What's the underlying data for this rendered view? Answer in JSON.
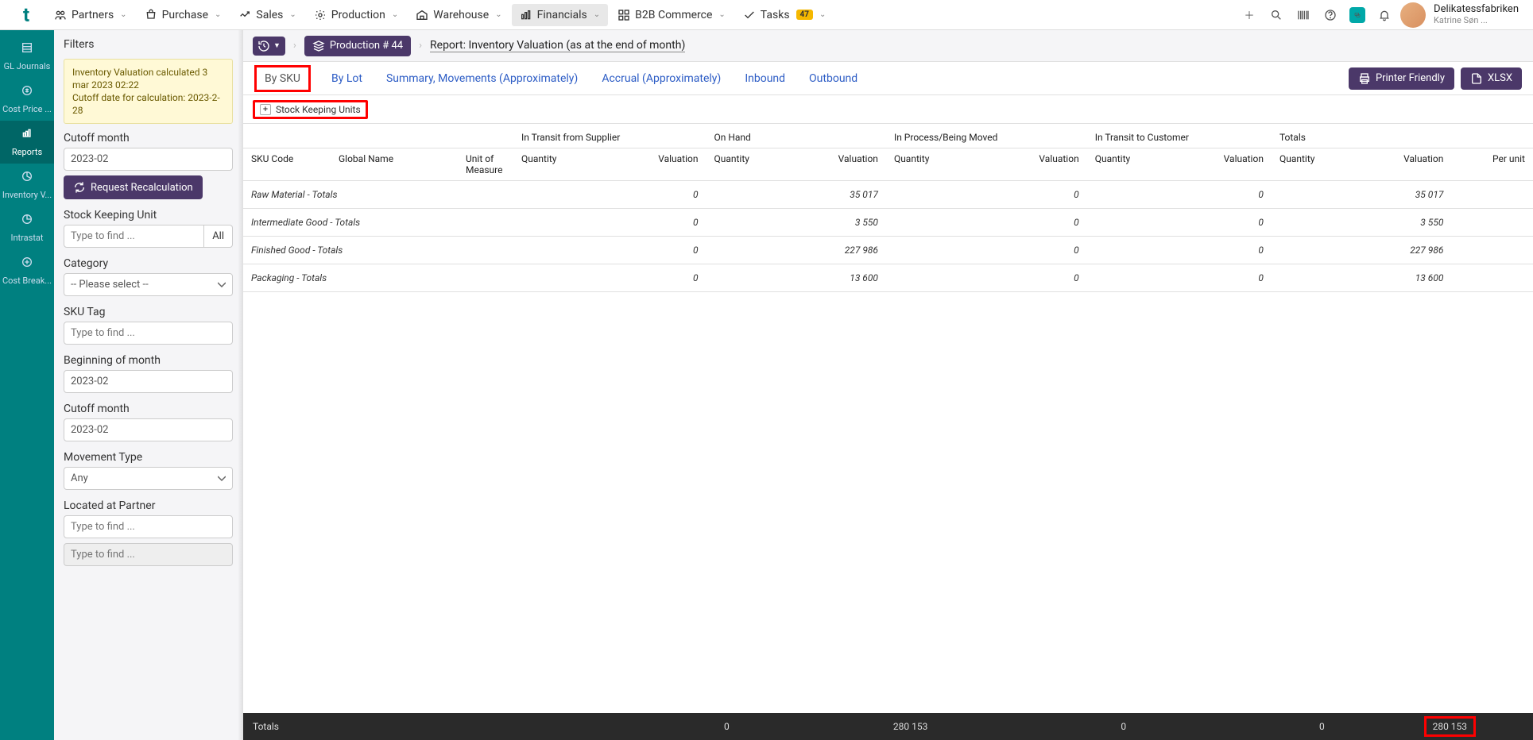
{
  "topnav": {
    "items": [
      {
        "label": "Partners"
      },
      {
        "label": "Purchase"
      },
      {
        "label": "Sales"
      },
      {
        "label": "Production"
      },
      {
        "label": "Warehouse"
      },
      {
        "label": "Financials",
        "active": true
      },
      {
        "label": "B2B Commerce"
      },
      {
        "label": "Tasks",
        "badge": "47"
      }
    ]
  },
  "user": {
    "company": "Delikatessfabriken",
    "name": "Katrine Søn ..."
  },
  "leftrail": {
    "items": [
      {
        "label": "GL Journals"
      },
      {
        "label": "Cost Price ..."
      },
      {
        "label": "Reports",
        "active": true
      },
      {
        "label": "Inventory V..."
      },
      {
        "label": "Intrastat"
      },
      {
        "label": "Cost Break..."
      }
    ]
  },
  "breadcrumb": {
    "chip": "Production # 44",
    "title": "Report: Inventory Valuation (as at the end of month)"
  },
  "tabs": {
    "items": [
      {
        "label": "By SKU",
        "active": true
      },
      {
        "label": "By Lot"
      },
      {
        "label": "Summary, Movements (Approximately)"
      },
      {
        "label": "Accrual (Approximately)"
      },
      {
        "label": "Inbound"
      },
      {
        "label": "Outbound"
      }
    ],
    "printer": "Printer Friendly",
    "xlsx": "XLSX"
  },
  "filters": {
    "title": "Filters",
    "info_line1": "Inventory Valuation calculated 3 mar 2023 02:22",
    "info_line2": "Cutoff date for calculation: 2023-2-28",
    "cutoff_label": "Cutoff month",
    "cutoff_value": "2023-02",
    "recalc": "Request Recalculation",
    "sku_label": "Stock Keeping Unit",
    "sku_placeholder": "Type to find ...",
    "all": "All",
    "category_label": "Category",
    "category_value": "-- Please select --",
    "skutag_label": "SKU Tag",
    "skutag_placeholder": "Type to find ...",
    "bom_label": "Beginning of month",
    "bom_value": "2023-02",
    "cutoff2_label": "Cutoff month",
    "cutoff2_value": "2023-02",
    "movtype_label": "Movement Type",
    "movtype_value": "Any",
    "located_label": "Located at Partner",
    "located_placeholder": "Type to find ...",
    "extra_placeholder": "Type to find ..."
  },
  "report": {
    "chip": "Stock Keeping Units",
    "group_headers": {
      "transit_supplier": "In Transit from Supplier",
      "on_hand": "On Hand",
      "in_process": "In Process/Being Moved",
      "transit_customer": "In Transit to Customer",
      "totals": "Totals"
    },
    "col_headers": {
      "sku_code": "SKU Code",
      "global_name": "Global Name",
      "uom": "Unit of Measure",
      "quantity": "Quantity",
      "valuation": "Valuation",
      "per_unit": "Per unit"
    },
    "rows": [
      {
        "name": "Raw Material - Totals",
        "q1": "",
        "v1": "0",
        "q2": "",
        "v2": "35 017",
        "q3": "",
        "v3": "0",
        "q4": "",
        "v4": "0",
        "qt": "",
        "vt": "35 017",
        "pu": ""
      },
      {
        "name": "Intermediate Good - Totals",
        "q1": "",
        "v1": "0",
        "q2": "",
        "v2": "3 550",
        "q3": "",
        "v3": "0",
        "q4": "",
        "v4": "0",
        "qt": "",
        "vt": "3 550",
        "pu": ""
      },
      {
        "name": "Finished Good - Totals",
        "q1": "",
        "v1": "0",
        "q2": "",
        "v2": "227 986",
        "q3": "",
        "v3": "0",
        "q4": "",
        "v4": "0",
        "qt": "",
        "vt": "227 986",
        "pu": ""
      },
      {
        "name": "Packaging - Totals",
        "q1": "",
        "v1": "0",
        "q2": "",
        "v2": "13 600",
        "q3": "",
        "v3": "0",
        "q4": "",
        "v4": "0",
        "qt": "",
        "vt": "13 600",
        "pu": ""
      }
    ],
    "footer": {
      "label": "Totals",
      "v1": "0",
      "v2": "280 153",
      "v3": "0",
      "v4": "0",
      "vt": "280 153"
    }
  }
}
